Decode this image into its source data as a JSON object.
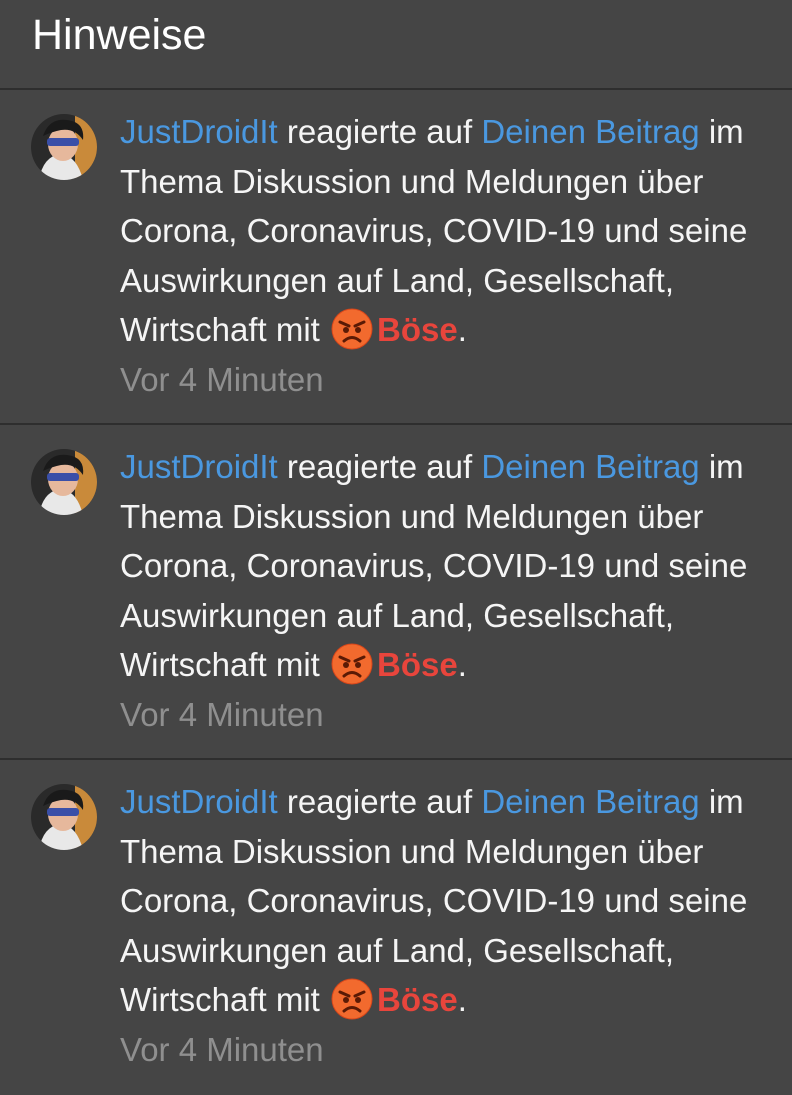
{
  "header": {
    "title": "Hinweise"
  },
  "colors": {
    "background": "#454545",
    "link": "#4a98e0",
    "reaction": "#e8453c",
    "muted": "#8f8f8f"
  },
  "notifications": [
    {
      "user": "JustDroidIt",
      "action": " reagierte auf ",
      "target": "Deinen Beitrag",
      "body": " im Thema Diskussion und Meldungen über Corona, Coronavirus, COVID-19 und seine Auswirkungen auf Land, Gesellschaft, Wirtschaft mit ",
      "reaction_icon": "angry-face-icon",
      "reaction": "Böse",
      "end": ".",
      "time": "Vor 4 Minuten"
    },
    {
      "user": "JustDroidIt",
      "action": " reagierte auf ",
      "target": "Deinen Beitrag",
      "body": " im Thema Diskussion und Meldungen über Corona, Coronavirus, COVID-19 und seine Auswirkungen auf Land, Gesellschaft, Wirtschaft mit ",
      "reaction_icon": "angry-face-icon",
      "reaction": "Böse",
      "end": ".",
      "time": "Vor 4 Minuten"
    },
    {
      "user": "JustDroidIt",
      "action": " reagierte auf ",
      "target": "Deinen Beitrag",
      "body": " im Thema Diskussion und Meldungen über Corona, Coronavirus, COVID-19 und seine Auswirkungen auf Land, Gesellschaft, Wirtschaft mit ",
      "reaction_icon": "angry-face-icon",
      "reaction": "Böse",
      "end": ".",
      "time": "Vor 4 Minuten"
    }
  ]
}
